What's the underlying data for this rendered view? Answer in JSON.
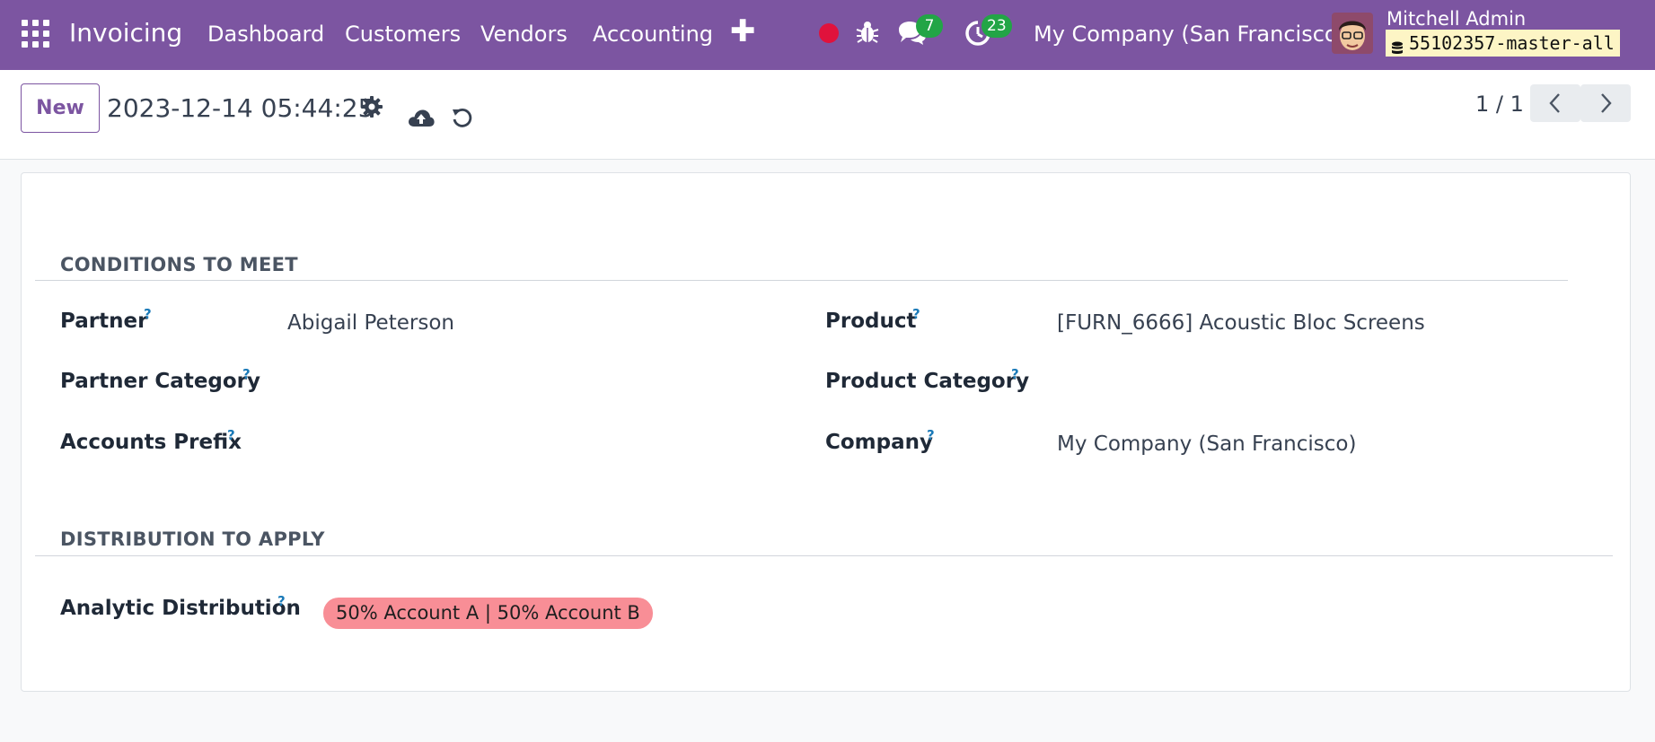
{
  "navbar": {
    "app_name": "Invoicing",
    "menu": [
      "Dashboard",
      "Customers",
      "Vendors",
      "Accounting"
    ],
    "messages_count": "7",
    "activities_count": "23",
    "company": "My Company (San Francisco)",
    "user_name": "Mitchell Admin",
    "db_name": "55102357-master-all",
    "icons": [
      "apps-grid-icon",
      "plus-icon",
      "record-dot-icon",
      "bug-icon",
      "chat-icon",
      "activity-clock-icon",
      "database-icon"
    ],
    "colors": {
      "bar": "#7c55a1",
      "badge": "#22a546",
      "record": "#e0123c",
      "db_bg": "#fdf5c5"
    }
  },
  "control_panel": {
    "new_label": "New",
    "record_title": "2023-12-14 05:44:25",
    "pager": "1 / 1",
    "icons": [
      "gear-icon",
      "cloud-upload-icon",
      "discard-icon",
      "chevron-left-icon",
      "chevron-right-icon"
    ]
  },
  "form": {
    "conditions_title": "CONDITIONS TO MEET",
    "help_mark": "?",
    "partner_label": "Partner",
    "partner_value": "Abigail Peterson",
    "partner_category_label": "Partner Category",
    "accounts_prefix_label": "Accounts Prefix",
    "product_label": "Product",
    "product_value": "[FURN_6666] Acoustic Bloc Screens",
    "product_category_label": "Product Category",
    "company_label": "Company",
    "company_value": "My Company (San Francisco)",
    "distribution_title": "DISTRIBUTION TO APPLY",
    "analytic_label": "Analytic Distribution",
    "analytic_tag": "50% Account A | 50% Account B",
    "colors": {
      "tag": "#f88e96",
      "help": "#1b7ab8"
    }
  }
}
